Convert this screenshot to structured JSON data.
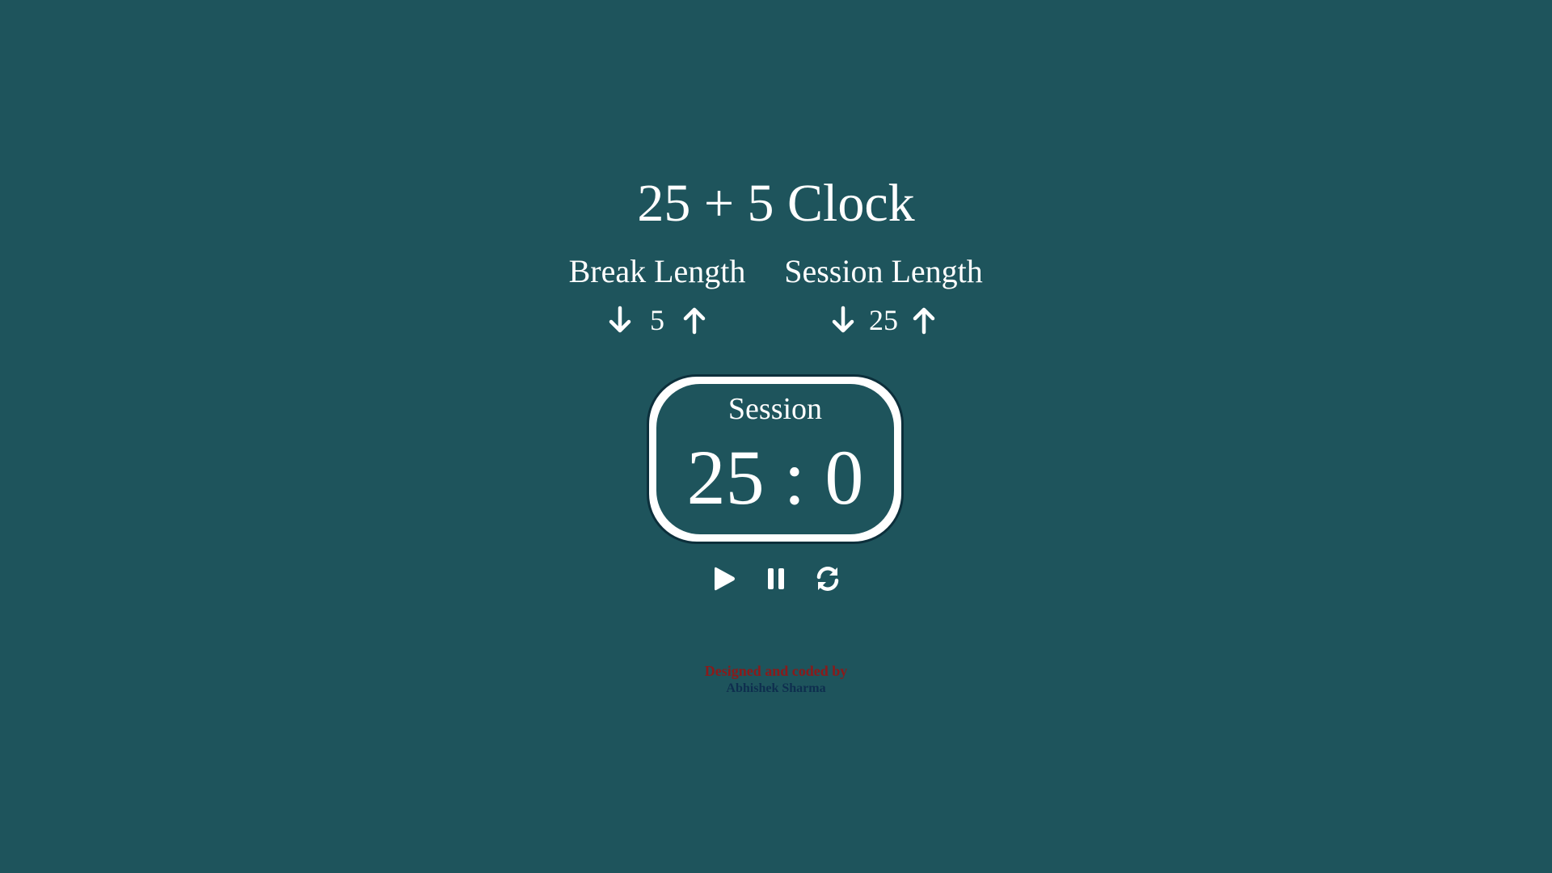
{
  "app": {
    "title": "25 + 5 Clock"
  },
  "break": {
    "label": "Break Length",
    "value": "5",
    "decrement_icon": "arrow-down-icon",
    "increment_icon": "arrow-up-icon"
  },
  "session": {
    "label": "Session Length",
    "value": "25",
    "decrement_icon": "arrow-down-icon",
    "increment_icon": "arrow-up-icon"
  },
  "timer": {
    "label": "Session",
    "time": "25 : 0"
  },
  "playback": {
    "play_icon": "play-icon",
    "pause_icon": "pause-icon",
    "reset_icon": "refresh-icon"
  },
  "credit": {
    "line1": "Designed and coded by",
    "line2": "Abhishek Sharma"
  },
  "colors": {
    "background": "#1e545c",
    "text": "#ffffff",
    "credit_line1": "#8b1a1a",
    "credit_line2": "#0e2e4e",
    "timer_border": "#ffffff"
  }
}
